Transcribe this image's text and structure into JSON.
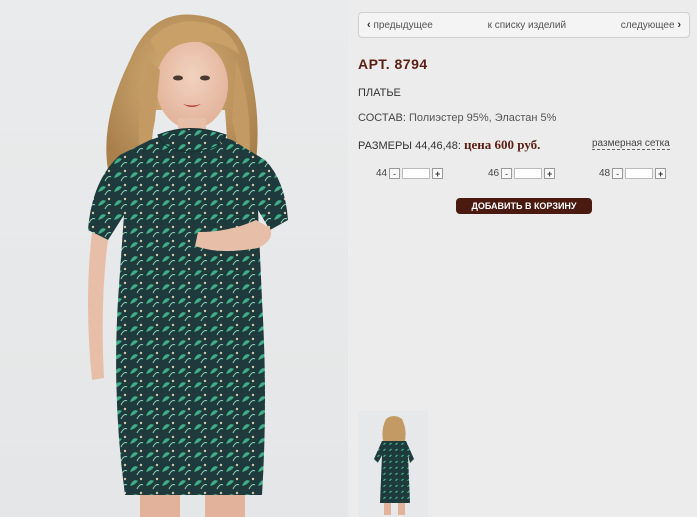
{
  "nav": {
    "prev_label": "предыдущее",
    "list_label": "к списку изделий",
    "next_label": "следующее"
  },
  "product": {
    "article": "АРТ. 8794",
    "type": "ПЛАТЬЕ",
    "composition_label": "СОСТАВ:",
    "composition_value": "Полиэстер 95%, Эластан 5%",
    "sizes_label": "РАЗМЕРЫ 44,46,48:",
    "price": "цена 600 руб.",
    "size_chart_link": "размерная сетка"
  },
  "quantities": [
    {
      "size": "44",
      "minus": "-",
      "plus": "+"
    },
    {
      "size": "46",
      "minus": "-",
      "plus": "+"
    },
    {
      "size": "48",
      "minus": "-",
      "plus": "+"
    }
  ],
  "add_to_cart": "ДОБАВИТЬ В КОРЗИНУ",
  "colors": {
    "accent": "#5a1e12",
    "button": "#4a1a10",
    "dress_base": "#1f3a3c",
    "dress_pattern": "#3fae86"
  }
}
